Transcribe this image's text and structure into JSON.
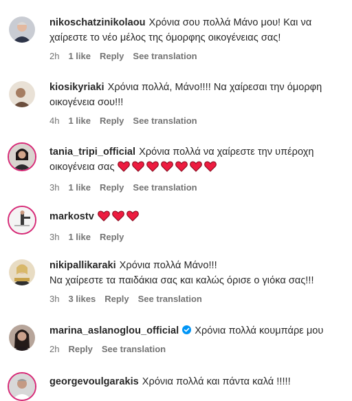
{
  "comments": [
    {
      "username": "nikoschatzinikolaou",
      "text": "Χρόνια σου πολλά Μάνο μου! Και να χαίρεστε το νέο μέλος της όμορφης οικογένειας σας!",
      "time": "2h",
      "likes": "1 like",
      "reply": "Reply",
      "translate": "See translation"
    },
    {
      "username": "kiosikyriaki",
      "text": "Χρόνια πολλά, Μάνο!!!! Να χαίρεσαι την όμορφη οικογένεια σου!!!",
      "time": "4h",
      "likes": "1 like",
      "reply": "Reply",
      "translate": "See translation"
    },
    {
      "username": "tania_tripi_official",
      "text": "Χρόνια πολλά να χαίρεστε την υπέροχη οικογένεια σας",
      "emoji": "❤️❤️❤️❤️❤️❤️❤️",
      "time": "3h",
      "likes": "1 like",
      "reply": "Reply",
      "translate": "See translation"
    },
    {
      "username": "markostv",
      "emoji": "❤️❤️❤️",
      "time": "3h",
      "likes": "1 like",
      "reply": "Reply"
    },
    {
      "username": "nikipallikaraki",
      "text": "Χρόνια πολλά Μάνο!!!",
      "text2": "Να χαίρεστε τα παιδάκια σας και καλώς όρισε ο γιόκα σας!!!",
      "time": "3h",
      "likes": "3 likes",
      "reply": "Reply",
      "translate": "See translation"
    },
    {
      "username": "marina_aslanoglou_official",
      "text": "Χρόνια πολλά κουμπάρε μου",
      "time": "2h",
      "reply": "Reply",
      "translate": "See translation"
    },
    {
      "username": "georgevoulgarakis",
      "text": "Χρόνια πολλά και πάντα καλά !!!!!"
    }
  ],
  "colors": {
    "text": "#262626",
    "meta": "#737373",
    "heart": "#ed1c40",
    "verified": "#0095f6",
    "story_ring": "#d62976"
  },
  "icons": {
    "heart": "red-heart-emoji",
    "verified": "verified-badge-icon"
  }
}
